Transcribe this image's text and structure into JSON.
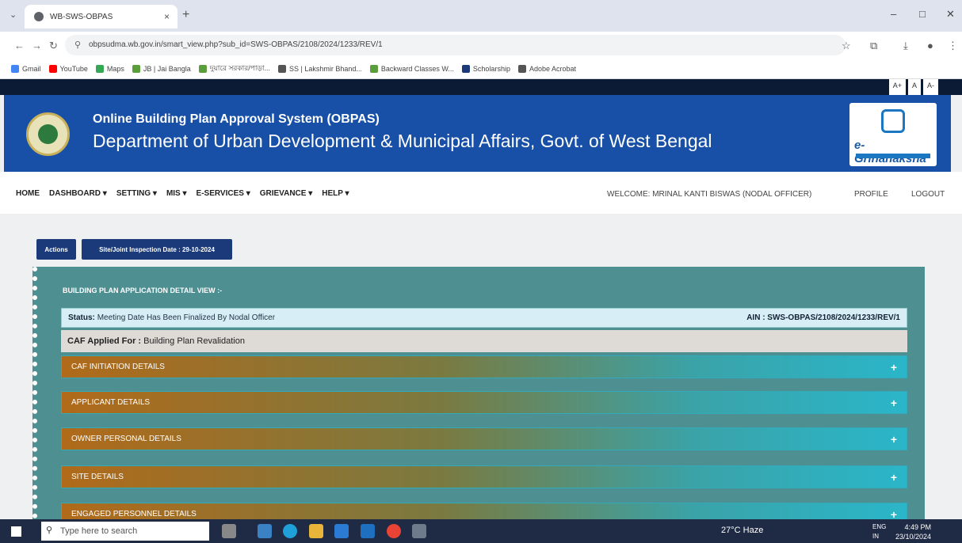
{
  "browser": {
    "tab_title": "WB-SWS-OBPAS",
    "tab_close": "×",
    "new_tab": "+",
    "url": "obpsudma.wb.gov.in/smart_view.php?sub_id=SWS-OBPAS/2108/2024/1233/REV/1",
    "bookmarks": [
      {
        "label": "Gmail",
        "color": "#4285f4"
      },
      {
        "label": "YouTube",
        "color": "#ff0000"
      },
      {
        "label": "Maps",
        "color": "#34a853"
      },
      {
        "label": "JB | Jai Bangla",
        "color": "#5a9e3c"
      },
      {
        "label": "দুয়ারে সরকার/পাড়া...",
        "color": "#5a9e3c"
      },
      {
        "label": "SS | Lakshmir Bhand...",
        "color": "#555555"
      },
      {
        "label": "Backward Classes W...",
        "color": "#5a9e3c"
      },
      {
        "label": "Scholarship",
        "color": "#1a3a7a"
      },
      {
        "label": "Adobe Acrobat",
        "color": "#555555"
      }
    ]
  },
  "header": {
    "font_buttons": [
      "A+",
      "A",
      "A-"
    ],
    "title_line1": "Online Building Plan Approval System (OBPAS)",
    "title_line2": "Department of Urban Development & Municipal Affairs, Govt. of West Bengal",
    "logo_text": "e-Grihanaksha"
  },
  "nav": {
    "items": [
      "HOME",
      "DASHBOARD ▾",
      "SETTING ▾",
      "MIS ▾",
      "E-SERVICES ▾",
      "GRIEVANCE ▾",
      "HELP ▾"
    ],
    "welcome": "WELCOME: MRINAL KANTI BISWAS (NODAL OFFICER)",
    "profile": "PROFILE",
    "logout": "LOGOUT"
  },
  "actions": {
    "actions_label": "Actions",
    "inspection_label": "Site/Joint Inspection Date : 29-10-2024"
  },
  "detail": {
    "title": "BUILDING PLAN APPLICATION DETAIL VIEW :-",
    "status_label": "Status:",
    "status_value": "Meeting Date Has Been Finalized By Nodal Officer",
    "ain": "AIN : SWS-OBPAS/2108/2024/1233/REV/1",
    "caf_label": "CAF Applied For :",
    "caf_value": "Building Plan Revalidation",
    "sections": [
      "CAF INITIATION DETAILS",
      "APPLICANT DETAILS",
      "OWNER PERSONAL DETAILS",
      "SITE DETAILS",
      "ENGAGED PERSONNEL DETAILS"
    ],
    "expand_symbol": "+"
  },
  "taskbar": {
    "search_placeholder": "Type here to search",
    "weather": "27°C Haze",
    "lang_line1": "ENG",
    "lang_line2": "IN",
    "time": "4:49 PM",
    "date": "23/10/2024"
  }
}
